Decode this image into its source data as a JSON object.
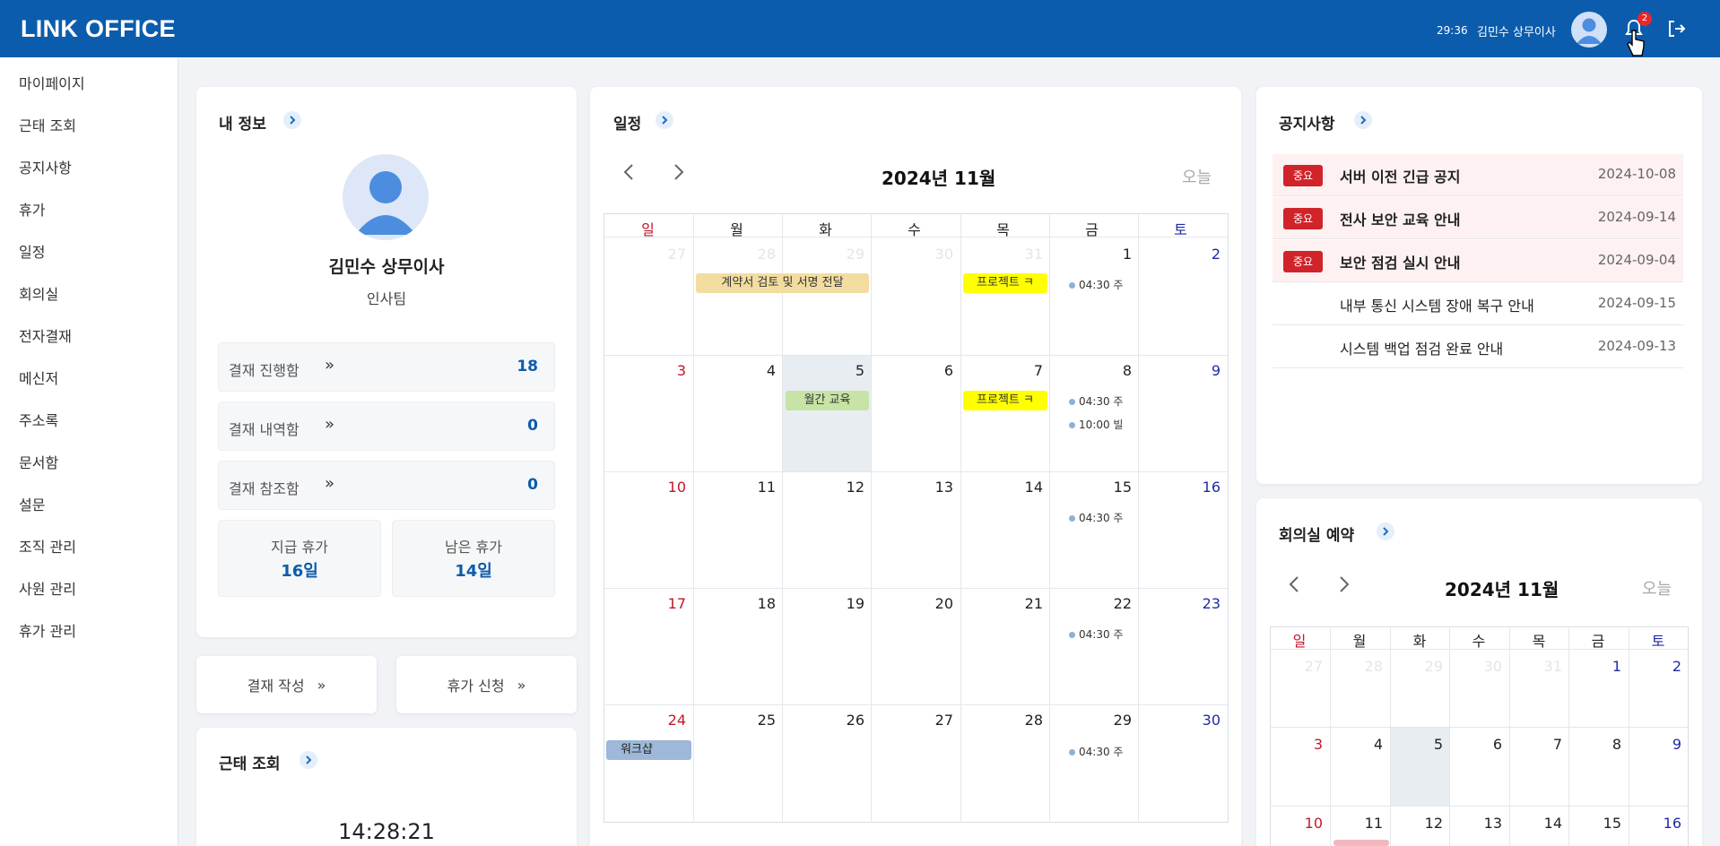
{
  "header": {
    "logo": "LINK OFFICE",
    "timer": "29:36",
    "user": "김민수 상무이사",
    "notification_count": "2"
  },
  "sidebar": {
    "items": [
      {
        "label": "마이페이지"
      },
      {
        "label": "근태 조회"
      },
      {
        "label": "공지사항"
      },
      {
        "label": "휴가"
      },
      {
        "label": "일정"
      },
      {
        "label": "회의실"
      },
      {
        "label": "전자결재"
      },
      {
        "label": "메신저"
      },
      {
        "label": "주소록"
      },
      {
        "label": "문서함"
      },
      {
        "label": "설문"
      },
      {
        "label": "조직 관리"
      },
      {
        "label": "사원 관리"
      },
      {
        "label": "휴가 관리"
      }
    ]
  },
  "my_info": {
    "title": "내 정보",
    "name": "김민수 상무이사",
    "team": "인사팀",
    "stats": [
      {
        "label": "결재 진행함",
        "arrow": "»",
        "value": "18"
      },
      {
        "label": "결재 내역함",
        "arrow": "»",
        "value": "0"
      },
      {
        "label": "결재 참조함",
        "arrow": "»",
        "value": "0"
      }
    ],
    "leave": [
      {
        "label": "지급 휴가",
        "value": "16일"
      },
      {
        "label": "남은 휴가",
        "value": "14일"
      }
    ]
  },
  "actions": {
    "approval_label": "결재 작성",
    "leave_label": "휴가 신청",
    "arrow": "»"
  },
  "attendance": {
    "title": "근태 조회",
    "clock": "14:28:21"
  },
  "schedule": {
    "title": "일정",
    "month": "2024년 11월",
    "today_label": "오늘",
    "weekdays": [
      "일",
      "월",
      "화",
      "수",
      "목",
      "금",
      "토"
    ],
    "weeks": [
      [
        "27",
        "28",
        "29",
        "30",
        "31",
        "1",
        "2"
      ],
      [
        "3",
        "4",
        "5",
        "6",
        "7",
        "8",
        "9"
      ],
      [
        "10",
        "11",
        "12",
        "13",
        "14",
        "15",
        "16"
      ],
      [
        "17",
        "18",
        "19",
        "20",
        "21",
        "22",
        "23"
      ],
      [
        "24",
        "25",
        "26",
        "27",
        "28",
        "29",
        "30"
      ]
    ],
    "events": {
      "contract": "계약서 검토 및 서명 전달",
      "project": "프로젝트 ㅋ",
      "monthly": "월간 교육",
      "workshop": "워크샵",
      "dot_0430": "04:30 주",
      "dot_1000": "10:00 빌"
    },
    "colors": {
      "contract": "#f3dca0",
      "project": "#ffff00",
      "monthly": "#c7e3a6",
      "workshop": "#9db8d8"
    }
  },
  "notices": {
    "title": "공지사항",
    "important_label": "중요",
    "items": [
      {
        "title": "서버 이전 긴급 공지",
        "date": "2024-10-08",
        "important": true
      },
      {
        "title": "전사 보안 교육 안내",
        "date": "2024-09-14",
        "important": true
      },
      {
        "title": "보안 점검 실시 안내",
        "date": "2024-09-04",
        "important": true
      },
      {
        "title": "내부 통신 시스템 장애 복구 안내",
        "date": "2024-09-15",
        "important": false
      },
      {
        "title": "시스템 백업 점검 완료 안내",
        "date": "2024-09-13",
        "important": false
      }
    ]
  },
  "meeting": {
    "title": "회의실 예약",
    "month": "2024년 11월",
    "today_label": "오늘",
    "weekdays": [
      "일",
      "월",
      "화",
      "수",
      "목",
      "금",
      "토"
    ],
    "weeks": [
      [
        "27",
        "28",
        "29",
        "30",
        "31",
        "1",
        "2"
      ],
      [
        "3",
        "4",
        "5",
        "6",
        "7",
        "8",
        "9"
      ],
      [
        "10",
        "11",
        "12",
        "13",
        "14",
        "15",
        "16"
      ]
    ]
  },
  "colors": {
    "brand": "#0b5cad",
    "accent": "#0b5cad",
    "important": "#d1232a",
    "sunday": "#c0182b",
    "saturday": "#1f2aa8"
  }
}
